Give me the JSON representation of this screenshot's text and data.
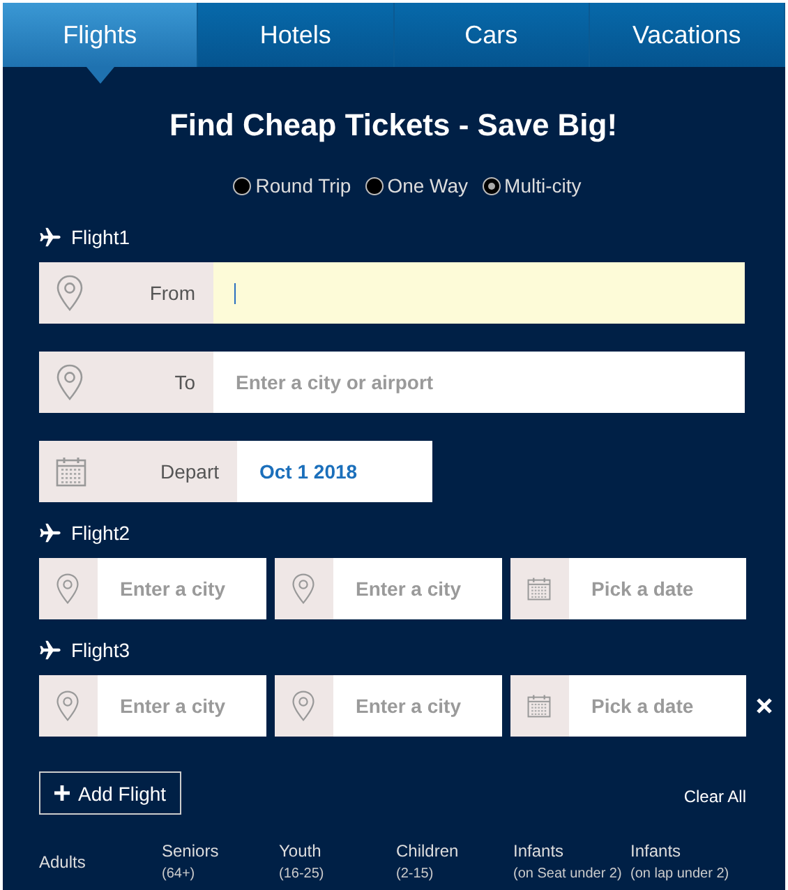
{
  "tabs": [
    {
      "label": "Flights",
      "selected": true
    },
    {
      "label": "Hotels",
      "selected": false
    },
    {
      "label": "Cars",
      "selected": false
    },
    {
      "label": "Vacations",
      "selected": false
    }
  ],
  "title": "Find Cheap Tickets - Save Big!",
  "trip_types": [
    {
      "label": "Round Trip",
      "selected": false
    },
    {
      "label": "One Way",
      "selected": false
    },
    {
      "label": "Multi-city",
      "selected": true
    }
  ],
  "flights": [
    {
      "label": "Flight1",
      "kind": "stacked",
      "removable": false,
      "fields": [
        {
          "kind": "city",
          "label": "From",
          "focused": true
        },
        {
          "kind": "city",
          "label": "To",
          "placeholder": "Enter a city or airport",
          "focused": false
        },
        {
          "kind": "date",
          "label": "Depart",
          "value": "Oct 1 2018",
          "focused": false
        }
      ]
    },
    {
      "label": "Flight2",
      "kind": "row",
      "removable": false,
      "fields": [
        {
          "kind": "city",
          "placeholder": "Enter a city",
          "focused": false
        },
        {
          "kind": "city",
          "placeholder": "Enter a city",
          "focused": false
        },
        {
          "kind": "date",
          "placeholder": "Pick a date",
          "focused": false
        }
      ]
    },
    {
      "label": "Flight3",
      "kind": "row",
      "removable": true,
      "fields": [
        {
          "kind": "city",
          "placeholder": "Enter a city",
          "focused": false
        },
        {
          "kind": "city",
          "placeholder": "Enter a city",
          "focused": false
        },
        {
          "kind": "date",
          "placeholder": "Pick a date",
          "focused": false
        }
      ]
    }
  ],
  "add_flight": "Add Flight",
  "clear_all": "Clear All",
  "passengers": [
    {
      "label": "Adults"
    },
    {
      "label": "Seniors",
      "note": "(64+)"
    },
    {
      "label": "Youth",
      "note": "(16-25)"
    },
    {
      "label": "Children",
      "note": "(2-15)"
    },
    {
      "label": "Infants",
      "note": "(on Seat under 2)"
    },
    {
      "label": "Infants",
      "note": "(on lap under 2)"
    }
  ]
}
